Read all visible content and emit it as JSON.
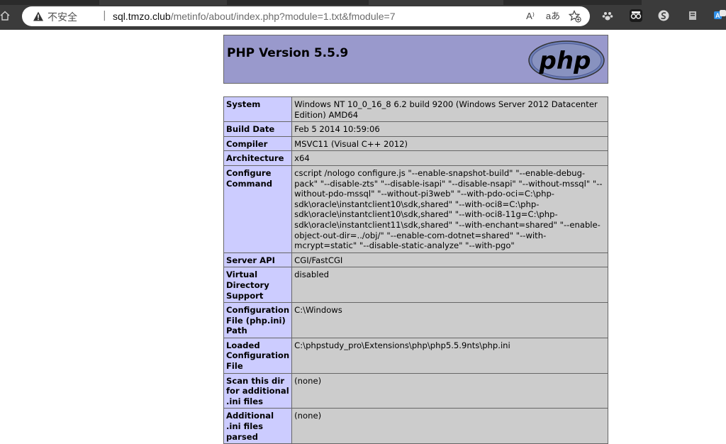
{
  "browser": {
    "security_label": "不安全",
    "separator": "|",
    "url_host": "sql.tmzo.club",
    "url_path": "/metinfo/about/index.php?module=1.txt&fmodule=7",
    "read_aloud_label": "A⁾",
    "translate_label": "aあ"
  },
  "phpinfo": {
    "title": "PHP Version 5.5.9",
    "logo_text": "php",
    "rows": [
      {
        "label": "System",
        "value": "Windows NT 10_0_16_8 6.2 build 9200 (Windows Server 2012 Datacenter Edition) AMD64"
      },
      {
        "label": "Build Date",
        "value": "Feb 5 2014 10:59:06"
      },
      {
        "label": "Compiler",
        "value": "MSVC11 (Visual C++ 2012)"
      },
      {
        "label": "Architecture",
        "value": "x64"
      },
      {
        "label": "Configure Command",
        "value": "cscript /nologo configure.js \"--enable-snapshot-build\" \"--enable-debug-pack\" \"--disable-zts\" \"--disable-isapi\" \"--disable-nsapi\" \"--without-mssql\" \"--without-pdo-mssql\" \"--without-pi3web\" \"--with-pdo-oci=C:\\php-sdk\\oracle\\instantclient10\\sdk,shared\" \"--with-oci8=C:\\php-sdk\\oracle\\instantclient10\\sdk,shared\" \"--with-oci8-11g=C:\\php-sdk\\oracle\\instantclient11\\sdk,shared\" \"--with-enchant=shared\" \"--enable-object-out-dir=../obj/\" \"--enable-com-dotnet=shared\" \"--with-mcrypt=static\" \"--disable-static-analyze\" \"--with-pgo\""
      },
      {
        "label": "Server API",
        "value": "CGI/FastCGI"
      },
      {
        "label": "Virtual Directory Support",
        "value": "disabled"
      },
      {
        "label": "Configuration File (php.ini) Path",
        "value": "C:\\Windows"
      },
      {
        "label": "Loaded Configuration File",
        "value": "C:\\phpstudy_pro\\Extensions\\php\\php5.5.9nts\\php.ini"
      },
      {
        "label": "Scan this dir for additional .ini files",
        "value": "(none)"
      },
      {
        "label": "Additional .ini files parsed",
        "value": "(none)"
      }
    ]
  }
}
